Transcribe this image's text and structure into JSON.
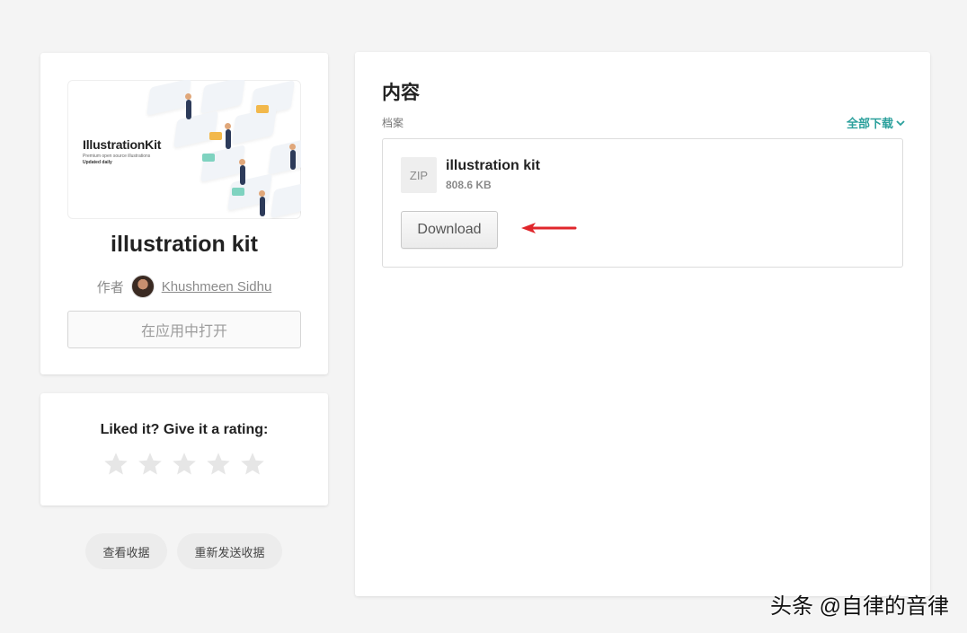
{
  "product": {
    "cover": {
      "title": "IllustrationKit",
      "subtitle": "Premium open source illustrations",
      "tagline": "Updated daily"
    },
    "title": "illustration kit",
    "author_label": "作者",
    "author_name": "Khushmeen Sidhu",
    "open_in_app_label": "在应用中打开"
  },
  "rating": {
    "prompt": "Liked it? Give it a rating:",
    "stars_total": 5,
    "stars_selected": 0,
    "star_color": "#e6e6e6"
  },
  "actions": {
    "view_receipt": "查看收据",
    "resend_receipt": "重新发送收据"
  },
  "content": {
    "title": "内容",
    "files_label": "档案",
    "download_all_label": "全部下载",
    "download_all_icon": "chevron-down-icon",
    "files": [
      {
        "type_label": "ZIP",
        "name": "illustration kit",
        "size": "808.6 KB",
        "download_label": "Download"
      }
    ]
  },
  "annotation": {
    "arrow_color": "#e0262b",
    "arrow_icon": "left-arrow-icon"
  },
  "watermark": "头条 @自律的音律",
  "colors": {
    "accent": "#2ba09c",
    "background": "#f4f4f4"
  }
}
